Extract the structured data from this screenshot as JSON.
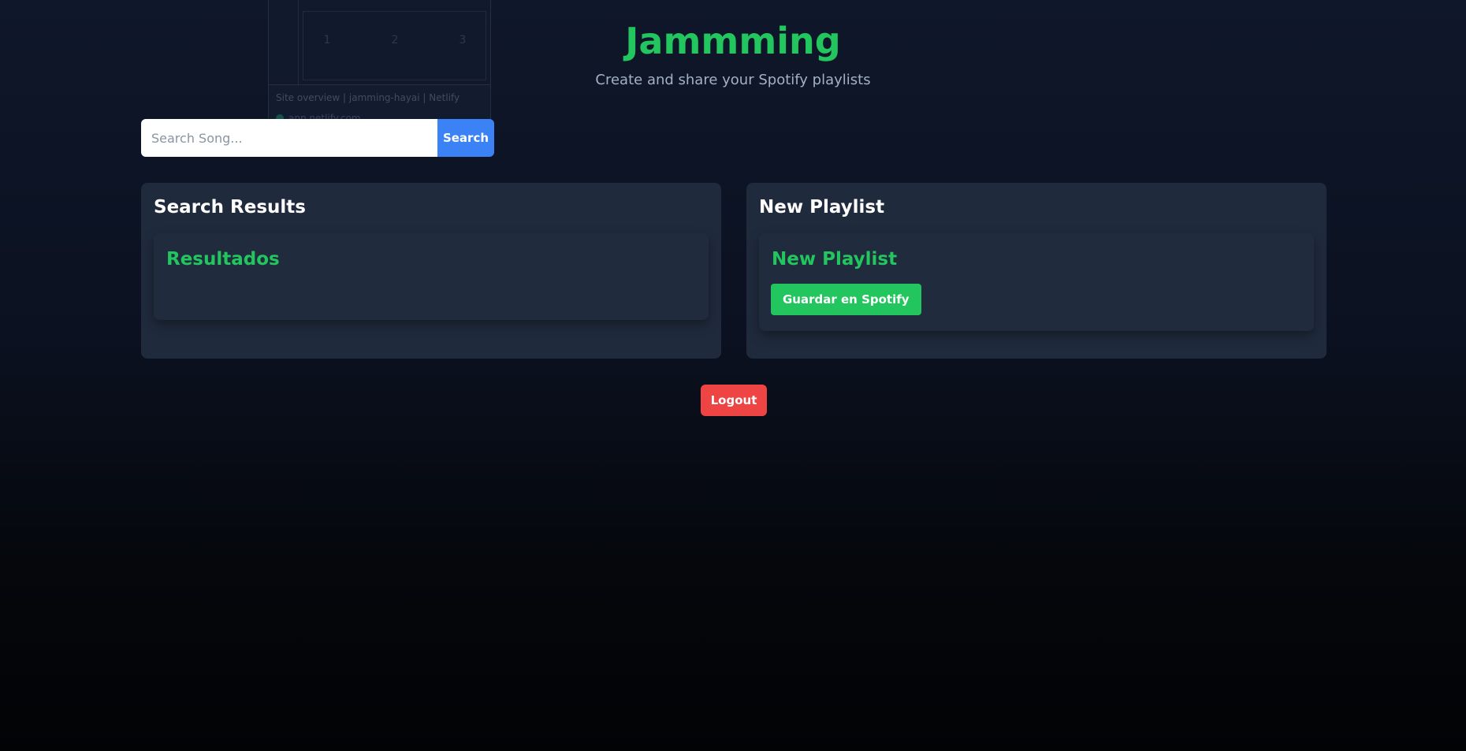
{
  "tab_preview": {
    "title": "Site overview | jamming-hayai | Netlify",
    "url": "app.netlify.com",
    "steps": [
      "1",
      "2",
      "3"
    ]
  },
  "header": {
    "title": "Jammming",
    "subtitle": "Create and share your Spotify playlists"
  },
  "search": {
    "placeholder": "Search Song...",
    "value": "",
    "button_label": "Search"
  },
  "results_panel": {
    "heading": "Search Results",
    "card_title": "Resultados"
  },
  "playlist_panel": {
    "heading": "New Playlist",
    "card_title": "New Playlist",
    "save_label": "Guardar en Spotify"
  },
  "logout_label": "Logout",
  "colors": {
    "accent_green": "#22c55e",
    "search_blue": "#3b82f6",
    "logout_red": "#ef4444",
    "panel_bg": "#1f2a3c",
    "page_bg_top": "#0f172a"
  }
}
